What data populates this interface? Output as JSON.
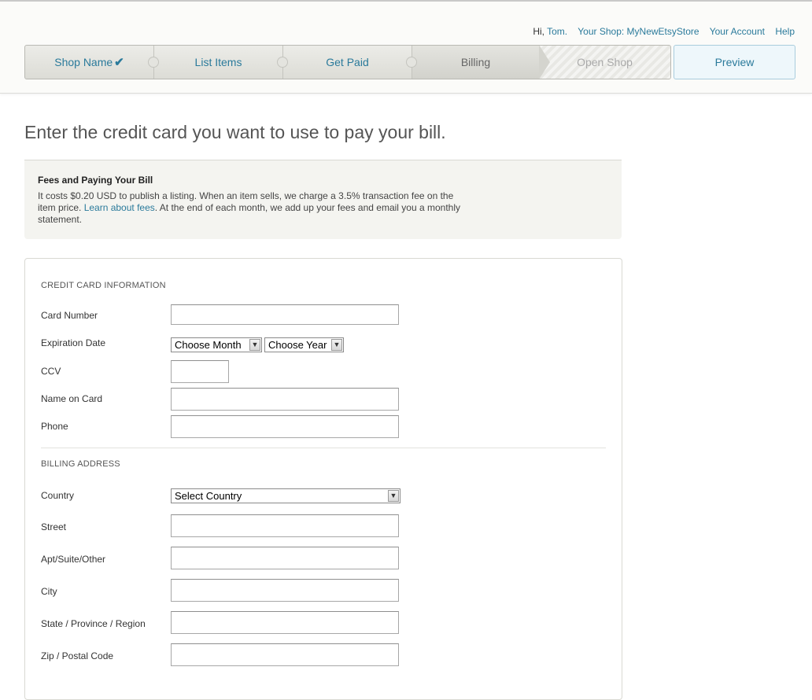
{
  "usernav": {
    "greeting": "Hi,",
    "name": "Tom.",
    "shop_link": "Your Shop: MyNewEtsyStore",
    "account_link": "Your Account",
    "help_link": "Help"
  },
  "steps": [
    {
      "label": "Shop Name",
      "done": true
    },
    {
      "label": "List Items"
    },
    {
      "label": "Get Paid"
    },
    {
      "label": "Billing",
      "current": true
    },
    {
      "label": "Open Shop",
      "disabled": true
    }
  ],
  "preview_label": "Preview",
  "page_title": "Enter the credit card you want to use to pay your bill.",
  "fees": {
    "heading": "Fees and Paying Your Bill",
    "text_before": "It costs $0.20 USD to publish a listing. When an item sells, we charge a 3.5% transaction fee on the item price. ",
    "link": "Learn about fees",
    "text_after": ". At the end of each month, we add up your fees and email you a monthly statement."
  },
  "credit_card": {
    "heading": "CREDIT CARD INFORMATION",
    "card_number_label": "Card Number",
    "expiration_label": "Expiration Date",
    "month_select": "Choose Month",
    "year_select": "Choose Year",
    "ccv_label": "CCV",
    "name_label": "Name on Card",
    "phone_label": "Phone"
  },
  "billing": {
    "heading": "BILLING ADDRESS",
    "country_label": "Country",
    "country_select": "Select Country",
    "street_label": "Street",
    "apt_label": "Apt/Suite/Other",
    "city_label": "City",
    "state_label": "State / Province / Region",
    "zip_label": "Zip / Postal Code"
  },
  "colors": {
    "link": "#2a7a9b",
    "title": "#555555"
  }
}
